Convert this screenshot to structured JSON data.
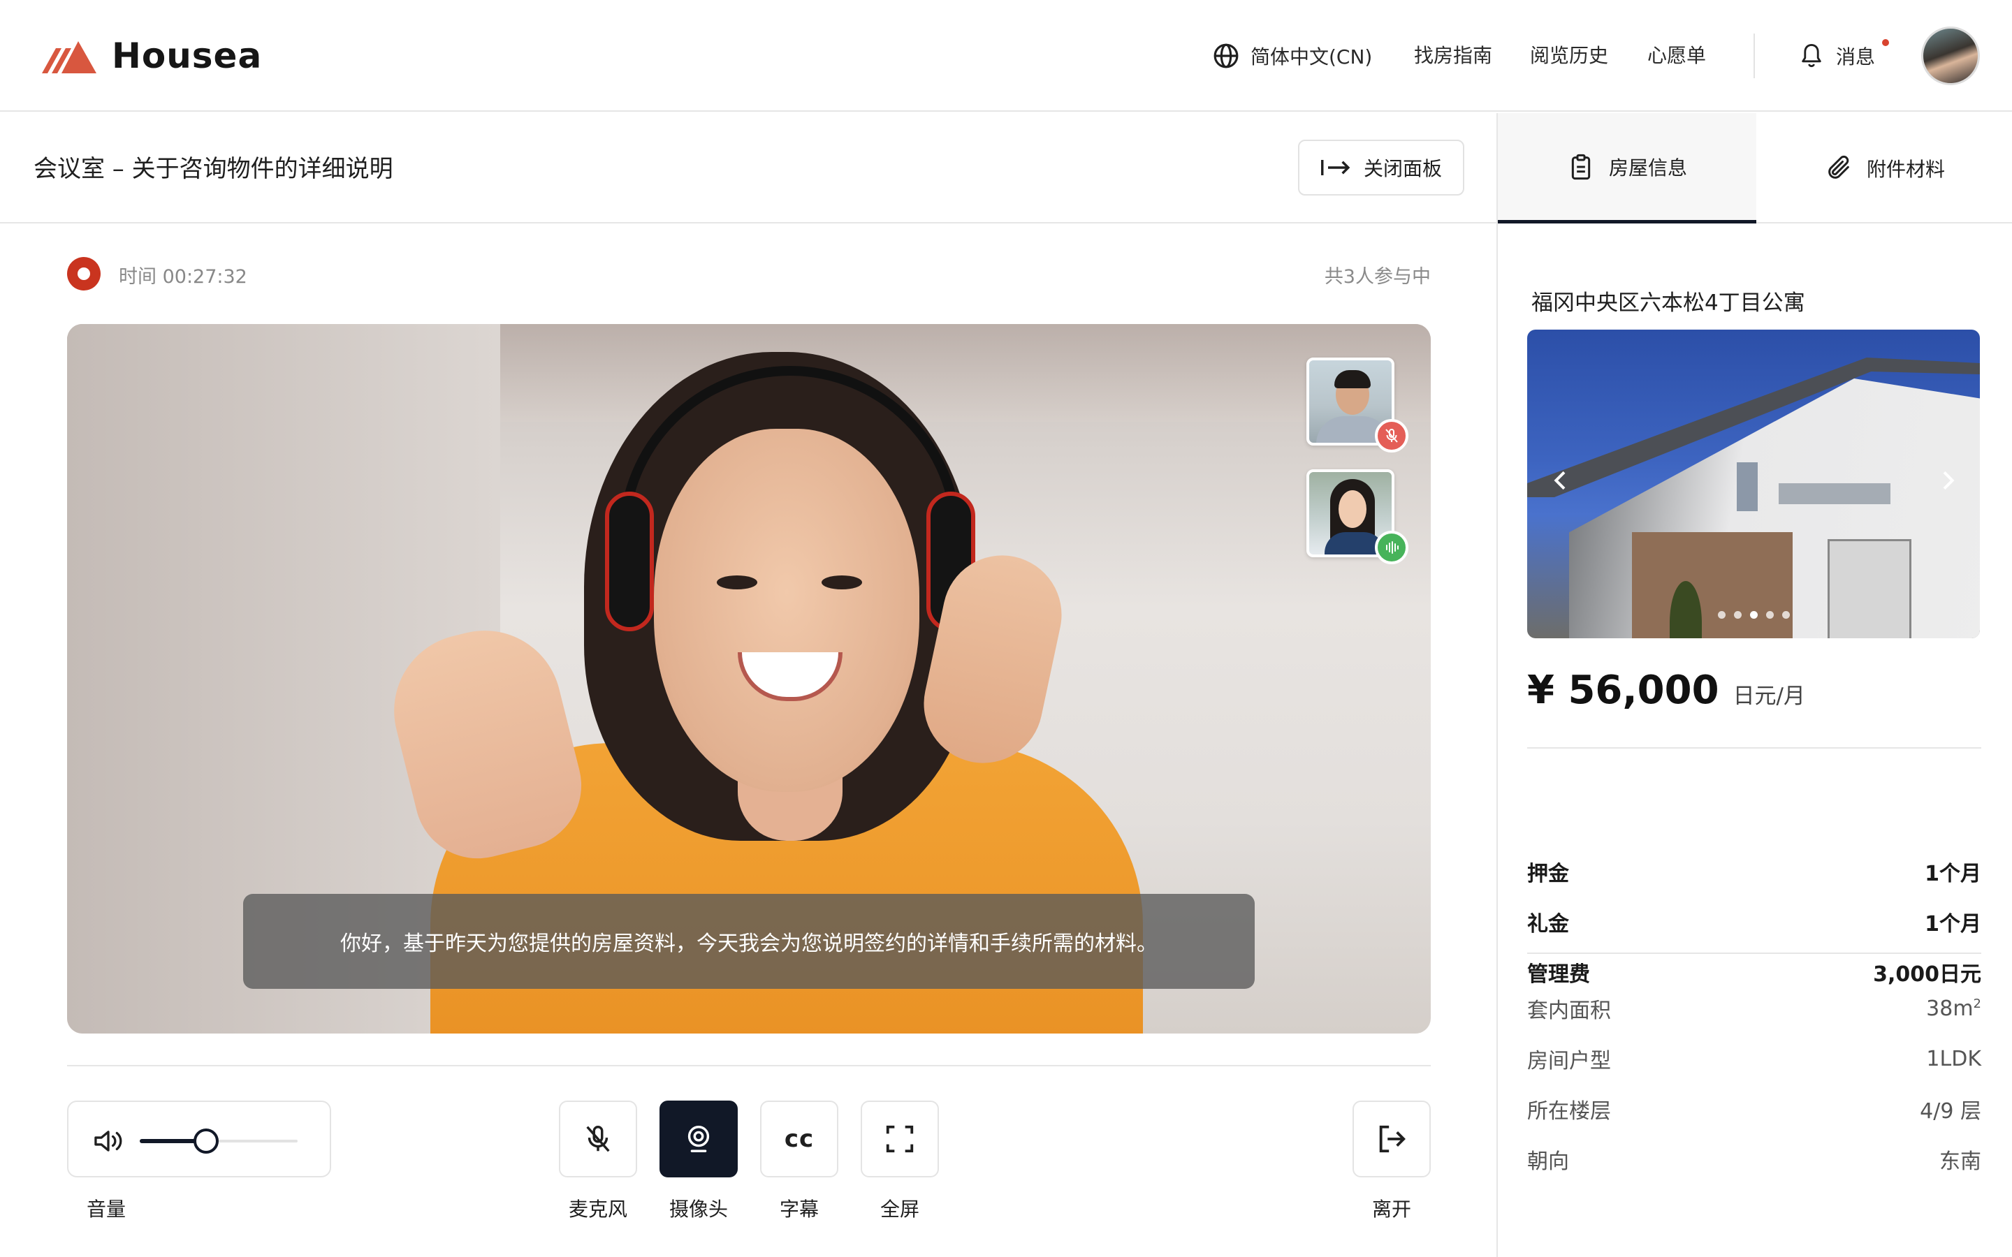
{
  "header": {
    "logo_text": "Housea",
    "language": "简体中文(CN)",
    "nav": [
      "找房指南",
      "阅览历史",
      "心愿单"
    ],
    "messages_label": "消息",
    "brand_color": "#D8573F",
    "notify_dot_color": "#D8432F"
  },
  "meeting": {
    "title": "会议室 – 关于咨询物件的详细说明",
    "close_panel_label": "关闭面板",
    "time_label": "时间 00:27:32",
    "participants": "共3人参与中",
    "subtitle_text": "你好，基于昨天为您提供的房屋资料，今天我会为您说明签约的详情和手续所需的材料。",
    "thumbnails": [
      {
        "name": "participant-male",
        "status": "muted",
        "badge_color": "#E45E57"
      },
      {
        "name": "participant-female",
        "status": "speaking",
        "badge_color": "#47B35A"
      }
    ],
    "volume": {
      "label": "音量",
      "level": 0.42
    },
    "controls": [
      {
        "label": "麦克风",
        "icon": "mic-off-icon"
      },
      {
        "label": "摄像头",
        "icon": "camera-icon",
        "active": true
      },
      {
        "label": "字幕",
        "icon_text": "cc"
      },
      {
        "label": "全屏",
        "icon": "fullscreen-icon"
      }
    ],
    "leave_label": "离开",
    "record_color": "#C9341F"
  },
  "panel": {
    "tabs": [
      "房屋信息",
      "附件材料"
    ],
    "active_tab": "房屋信息",
    "property_title": "福冈中央区六本松4丁目公寓",
    "carousel_dots": 5,
    "carousel_active": 2,
    "price": "¥ 56,000",
    "price_unit": "日元/月",
    "fees": [
      {
        "k": "押金",
        "v": "1个月"
      },
      {
        "k": "礼金",
        "v": "1个月"
      },
      {
        "k": "管理费",
        "v": "3,000日元"
      }
    ],
    "details": [
      {
        "k": "套内面积",
        "v": "38m",
        "sup": "2"
      },
      {
        "k": "房间户型",
        "v": "1LDK"
      },
      {
        "k": "所在楼层",
        "v": "4/9 层"
      },
      {
        "k": "朝向",
        "v": "东南"
      }
    ],
    "accent_dark": "#111827"
  }
}
